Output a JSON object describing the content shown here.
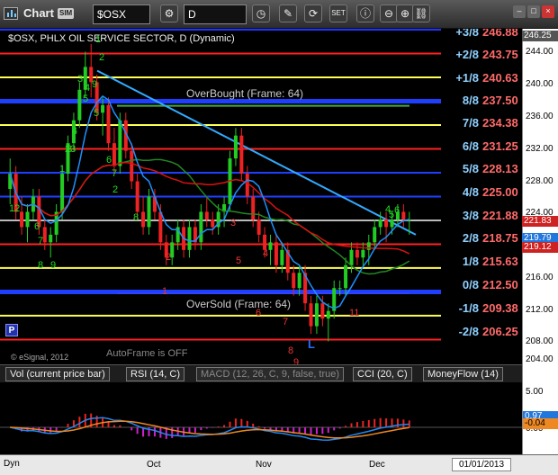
{
  "toolbar": {
    "title": "Chart",
    "badge": "SIM",
    "symbol": "$OSX",
    "interval": "D"
  },
  "chart": {
    "title": "$OSX, PHLX OIL SERVICE SECTOR, D (Dynamic)",
    "overbought_label": "OverBought (Frame: 64)",
    "oversold_label": "OverSold (Frame: 64)",
    "autoframe": "AutoFrame is OFF",
    "copyright": "© eSignal, 2012",
    "p_button": "P",
    "low_marker": "L"
  },
  "murrey_lines": [
    {
      "frac": "+3/8",
      "price": "246.88",
      "color": "#2233ff"
    },
    {
      "frac": "+2/8",
      "price": "243.75",
      "color": "#ff2222"
    },
    {
      "frac": "+1/8",
      "price": "240.63",
      "color": "#ffff55"
    },
    {
      "frac": "8/8",
      "price": "237.50",
      "color": "#1f3fff"
    },
    {
      "frac": "7/8",
      "price": "234.38",
      "color": "#ffff55"
    },
    {
      "frac": "6/8",
      "price": "231.25",
      "color": "#ff2222"
    },
    {
      "frac": "5/8",
      "price": "228.13",
      "color": "#1f3fff"
    },
    {
      "frac": "4/8",
      "price": "225.00",
      "color": "#1f3fff"
    },
    {
      "frac": "3/8",
      "price": "221.88",
      "color": "#bbbbbb"
    },
    {
      "frac": "2/8",
      "price": "218.75",
      "color": "#ff2222"
    },
    {
      "frac": "1/8",
      "price": "215.63",
      "color": "#ffff55"
    },
    {
      "frac": "0/8",
      "price": "212.50",
      "color": "#1f3fff"
    },
    {
      "frac": "-1/8",
      "price": "209.38",
      "color": "#ffff55"
    },
    {
      "frac": "-2/8",
      "price": "206.25",
      "color": "#ff2222"
    }
  ],
  "y_axis": {
    "ticks": [
      "244.00",
      "240.00",
      "236.00",
      "232.00",
      "228.00",
      "224.00",
      "220.00",
      "216.00",
      "212.00",
      "208.00",
      "204.00"
    ],
    "top_tag": "246.25",
    "tag_last": "221.83",
    "tag_ma": "219.79",
    "tag_ma2": "219.12",
    "tag_last_color": "#cc2222",
    "tag_ma_color": "#2277dd",
    "tag_ma2_color": "#cc2222"
  },
  "seq_counts_green": [
    "1",
    "2",
    "3",
    "4",
    "5",
    "6",
    "7",
    "8",
    "9",
    "12",
    "1",
    "2",
    "3",
    "4",
    "5",
    "6",
    "7",
    "8",
    "9",
    "23",
    "4",
    "5",
    "6"
  ],
  "seq_counts_red": [
    "1",
    "2",
    "3",
    "4",
    "5",
    "6",
    "7",
    "8",
    "9",
    "11"
  ],
  "indicator_tabs": [
    {
      "label": "Vol (current price bar)",
      "dim": false
    },
    {
      "label": "RSI (14, C)",
      "dim": false
    },
    {
      "label": "MACD (12, 26, C, 9, false, true)",
      "dim": true
    },
    {
      "label": "CCI (20, C)",
      "dim": false
    },
    {
      "label": "MoneyFlow (14)",
      "dim": false
    }
  ],
  "macd_axis": {
    "ticks": [
      "5.00",
      "0.00"
    ],
    "tag1": "0.97",
    "tag2": "-0.04"
  },
  "x_axis": {
    "labels": [
      "Oct",
      "Nov",
      "Dec"
    ],
    "dyn": "Dyn",
    "date": "01/01/2013"
  },
  "colors": {
    "candle_up": "#22cc22",
    "candle_down": "#ee2222",
    "ma_fast": "#1e90ff",
    "ma_slow": "#dd1111",
    "ma_mid": "#228822",
    "trendline": "#33aaff"
  },
  "chart_data": {
    "type": "candlestick",
    "title": "$OSX, PHLX OIL SERVICE SECTOR, D (Dynamic)",
    "ylim": [
      203,
      247
    ],
    "x_labels": [
      "Oct",
      "Nov",
      "Dec"
    ],
    "candles": [
      [
        226,
        230,
        224,
        228
      ],
      [
        228,
        229,
        222,
        223
      ],
      [
        223,
        225,
        220,
        221
      ],
      [
        221,
        224,
        219,
        223
      ],
      [
        223,
        226,
        222,
        225
      ],
      [
        225,
        226,
        220,
        221
      ],
      [
        221,
        222,
        218,
        219
      ],
      [
        219,
        221,
        217,
        220
      ],
      [
        220,
        224,
        219,
        223
      ],
      [
        223,
        229,
        222,
        228
      ],
      [
        228,
        233,
        227,
        232
      ],
      [
        232,
        236,
        231,
        235
      ],
      [
        235,
        240,
        234,
        239
      ],
      [
        239,
        244,
        238,
        242
      ],
      [
        242,
        245,
        238,
        240
      ],
      [
        240,
        241,
        235,
        236
      ],
      [
        236,
        238,
        233,
        237
      ],
      [
        237,
        238,
        231,
        232
      ],
      [
        232,
        234,
        228,
        229
      ],
      [
        229,
        236,
        228,
        235
      ],
      [
        235,
        236,
        230,
        231
      ],
      [
        231,
        232,
        226,
        227
      ],
      [
        227,
        228,
        222,
        223
      ],
      [
        223,
        225,
        220,
        221
      ],
      [
        221,
        226,
        220,
        225
      ],
      [
        225,
        226,
        222,
        223
      ],
      [
        223,
        224,
        218,
        219
      ],
      [
        219,
        220,
        216,
        217
      ],
      [
        217,
        220,
        216,
        219
      ],
      [
        219,
        222,
        218,
        221
      ],
      [
        221,
        222,
        217,
        218
      ],
      [
        218,
        222,
        217,
        221
      ],
      [
        221,
        222,
        218,
        219
      ],
      [
        219,
        224,
        218,
        223
      ],
      [
        223,
        225,
        221,
        222
      ],
      [
        222,
        223,
        220,
        221
      ],
      [
        221,
        224,
        220,
        223
      ],
      [
        223,
        225,
        221,
        224
      ],
      [
        224,
        231,
        223,
        230
      ],
      [
        230,
        234,
        229,
        233
      ],
      [
        233,
        234,
        227,
        228
      ],
      [
        228,
        229,
        224,
        225
      ],
      [
        225,
        226,
        221,
        222
      ],
      [
        222,
        223,
        219,
        220
      ],
      [
        220,
        221,
        217,
        218
      ],
      [
        218,
        220,
        216,
        219
      ],
      [
        219,
        220,
        215,
        216
      ],
      [
        216,
        219,
        215,
        218
      ],
      [
        218,
        219,
        214,
        215
      ],
      [
        215,
        216,
        212,
        213
      ],
      [
        213,
        216,
        212,
        215
      ],
      [
        215,
        216,
        210,
        211
      ],
      [
        211,
        212,
        207,
        208
      ],
      [
        208,
        212,
        207,
        211
      ],
      [
        211,
        212,
        208,
        209
      ],
      [
        209,
        211,
        206,
        210
      ],
      [
        210,
        214,
        209,
        213
      ],
      [
        213,
        214,
        212,
        213
      ],
      [
        213,
        217,
        212,
        216
      ],
      [
        216,
        219,
        215,
        218
      ],
      [
        218,
        219,
        216,
        217
      ],
      [
        217,
        219,
        216,
        218
      ],
      [
        218,
        220,
        216,
        219
      ],
      [
        219,
        222,
        218,
        221
      ],
      [
        221,
        223,
        220,
        222
      ],
      [
        222,
        223,
        219,
        221
      ],
      [
        221,
        223,
        220,
        222
      ],
      [
        222,
        224,
        221,
        223
      ],
      [
        223,
        224,
        221,
        222
      ],
      [
        222,
        223,
        220,
        222
      ]
    ]
  }
}
